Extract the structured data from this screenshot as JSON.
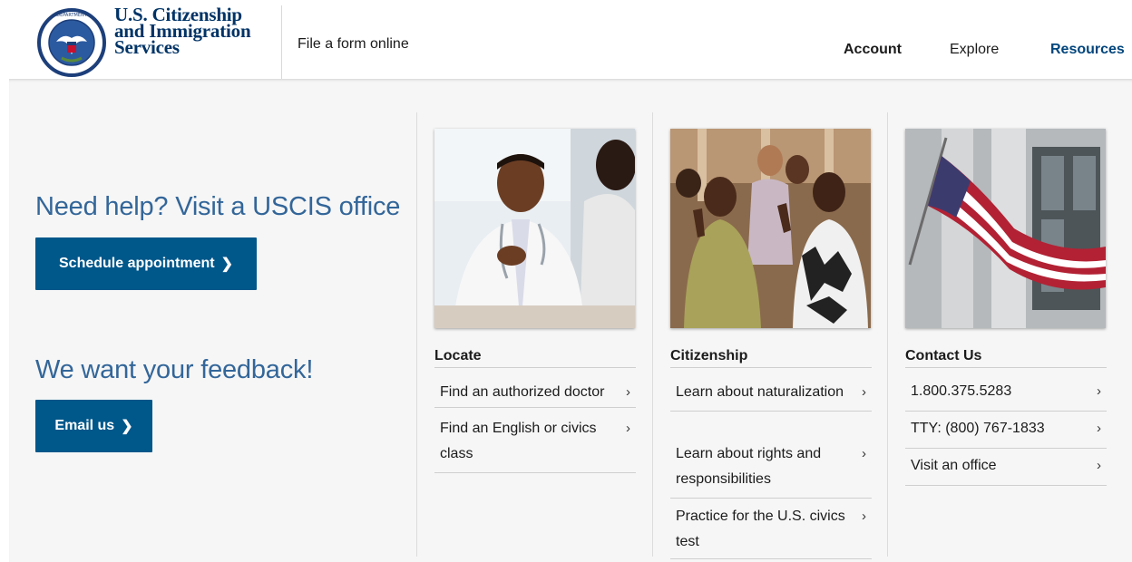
{
  "header": {
    "agency_line1": "U.S. Citizenship",
    "agency_line2": "and Immigration",
    "agency_line3": "Services",
    "file_online": "File a form online",
    "nav": {
      "account": "Account",
      "explore": "Explore",
      "resources": "Resources"
    }
  },
  "help": {
    "title": "Need help? Visit a USCIS office",
    "schedule_label": "Schedule appointment",
    "feedback_title": "We want your feedback!",
    "email_label": "Email us"
  },
  "columns": {
    "locate": {
      "heading": "Locate",
      "links": [
        "Find an authorized doctor",
        "Find an English or civics class"
      ]
    },
    "citizenship": {
      "heading": "Citizenship",
      "links": [
        "Learn about naturalization",
        "Learn about rights and responsibilities",
        "Practice for the U.S. civics test"
      ]
    },
    "contact": {
      "heading": "Contact Us",
      "links": [
        "1.800.375.5283",
        "TTY: (800) 767-1833",
        "Visit an office"
      ]
    }
  },
  "glyphs": {
    "chevron": "›",
    "button_chevron": "❯"
  },
  "colors": {
    "brand_navy": "#003366",
    "button_blue": "#00578a",
    "heading_blue": "#336699"
  }
}
